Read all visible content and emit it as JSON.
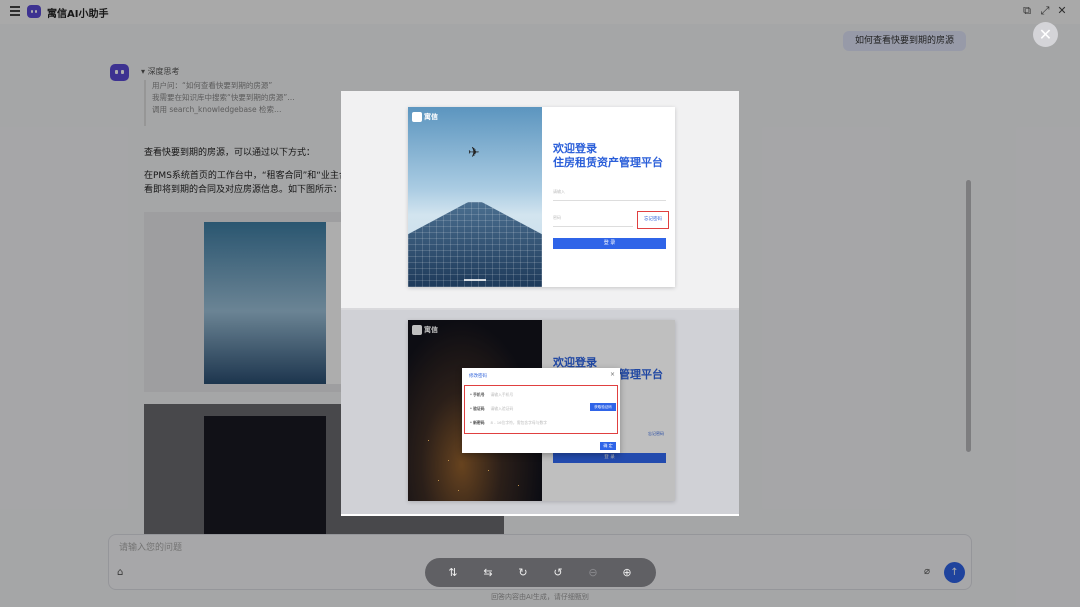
{
  "app": {
    "title": "寓信AI小助手"
  },
  "titlebar": {
    "menu_icon": "menu-icon",
    "controls": [
      "⧉",
      "⤢",
      "✕"
    ]
  },
  "chat": {
    "user_question": "如何查看快要到期的房源",
    "think_label": "深度思考",
    "think_lines": [
      "用户问：“如何查看快要到期的房源”",
      "我需要在知识库中搜索“快要到期的房源”…",
      "调用 search_knowledgebase 检索…"
    ],
    "answer_lines": [
      "查看快要到期的房源，可以通过以下方式：",
      "在PMS系统首页的工作台中，“租客合同”和“业主合",
      "看即将到期的合同及对应房源信息。如下图所示："
    ]
  },
  "preview": {
    "login_title_1": "欢迎登录",
    "login_title_2": "住房租赁资产管理平台",
    "brand": "寓信",
    "username_placeholder": "请输入",
    "password_placeholder": "密码",
    "forgot_label": "忘记密码",
    "login_button": "登 录",
    "dialog_title": "修改密码",
    "dialog_rows": [
      {
        "label": "手机号",
        "placeholder": "请输入手机号"
      },
      {
        "label": "验证码",
        "placeholder": "请输入验证码"
      },
      {
        "label": "新密码",
        "placeholder": "8 - 16位字符，需包含字母与数字"
      }
    ],
    "get_code": "获取验证码",
    "dialog_ok": "确 定",
    "card2_link": "忘记密码"
  },
  "input": {
    "placeholder": "请输入您的问题"
  },
  "footer": {
    "note": "回答内容由AI生成，请仔细甄别"
  },
  "toolbar": {
    "tools": [
      "flip-vertical-icon",
      "flip-horizontal-icon",
      "rotate-right-icon",
      "rotate-left-icon",
      "zoom-out-icon",
      "zoom-in-icon"
    ]
  },
  "colors": {
    "accent": "#2f64e8",
    "highlight": "#e04040",
    "brand": "#5b4bd6"
  }
}
